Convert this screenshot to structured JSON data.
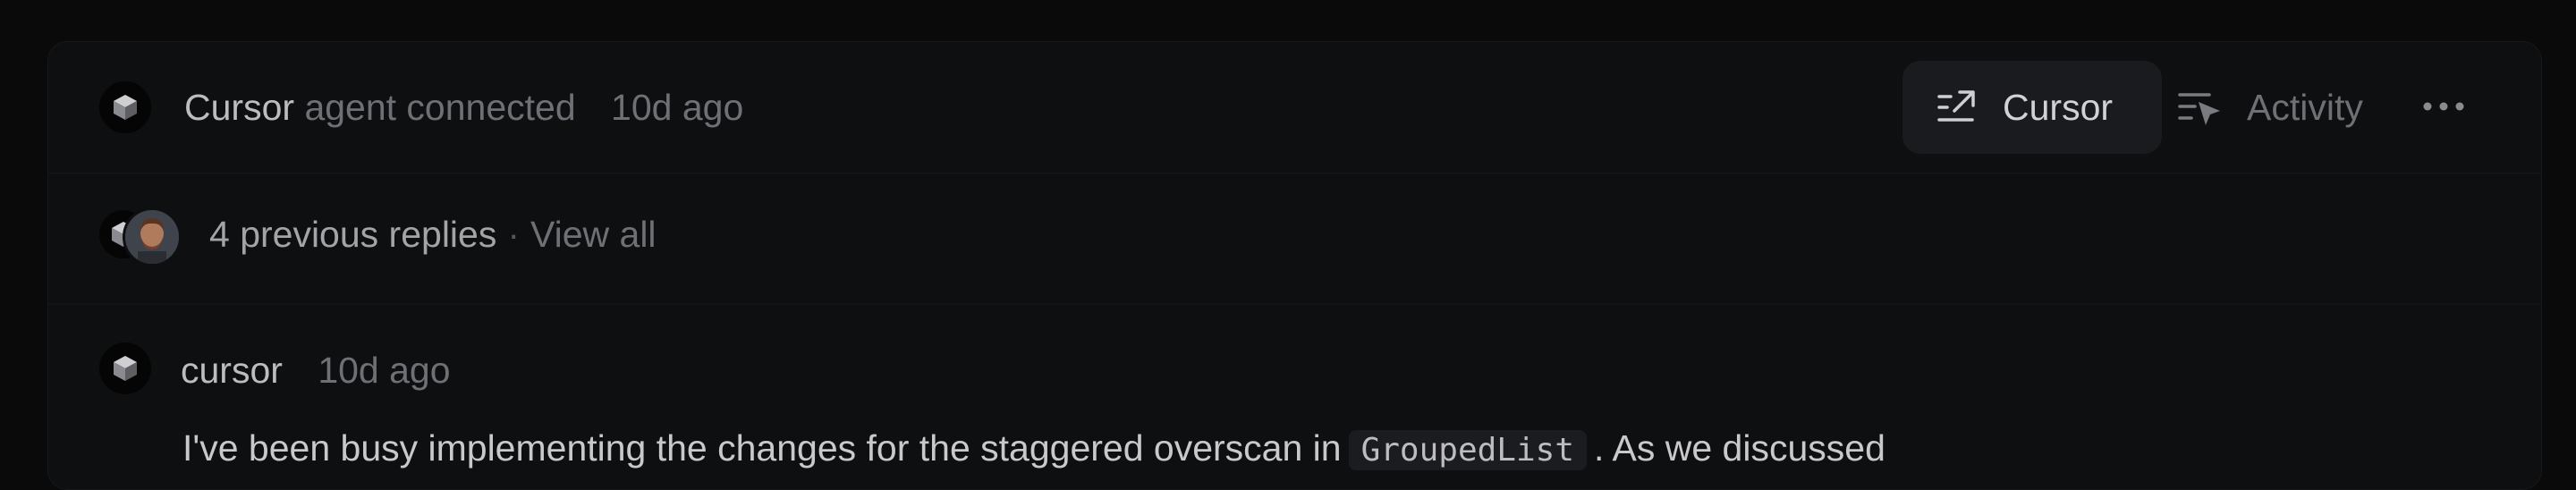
{
  "header": {
    "agent_name": "Cursor",
    "action_text": "agent connected",
    "time": "10d ago",
    "tabs": [
      {
        "label": "Cursor",
        "icon": "open-in-editor-icon",
        "active": true
      },
      {
        "label": "Activity",
        "icon": "activity-icon",
        "active": false
      }
    ],
    "more_icon": "more-horizontal-icon"
  },
  "previous": {
    "count_text": "4 previous replies",
    "separator": "·",
    "link_text": "View all"
  },
  "message": {
    "author": "cursor",
    "time": "10d ago",
    "body_before": "I've been busy implementing the changes for the staggered overscan in",
    "code": "GroupedList",
    "body_after": ". As we discussed"
  },
  "colors": {
    "background": "#0a0a0b",
    "card": "#0e0f11",
    "active_tab": "#1a1b1e",
    "muted_text": "#6f7075",
    "primary_text": "#bdbdc1"
  }
}
